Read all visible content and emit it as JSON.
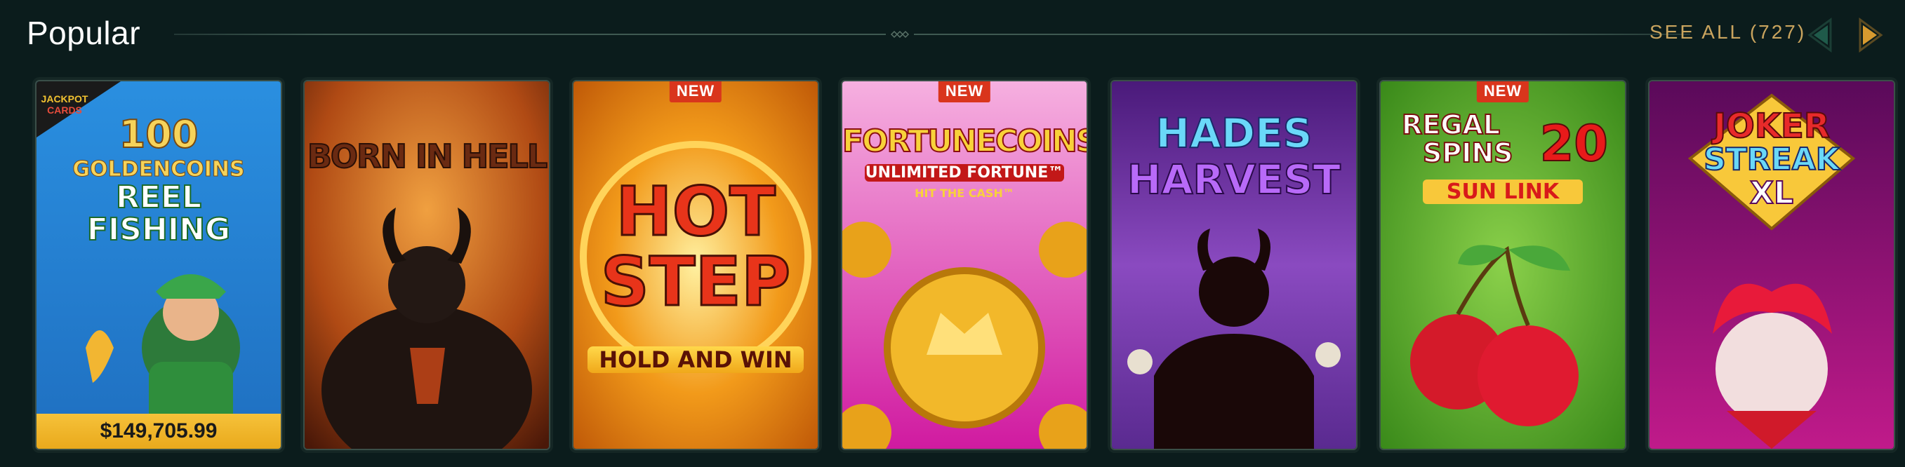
{
  "section": {
    "title": "Popular",
    "see_all_label": "SEE ALL (727)"
  },
  "nav": {
    "prev_icon": "chevron-left-icon",
    "next_icon": "chevron-right-icon",
    "prev_color": "#1f5a4a",
    "next_color": "#d79a2f"
  },
  "games": [
    {
      "title": "100 GOLDENCOINS REEL FISHING",
      "title_lines": [
        "100",
        "GOLDENCOINS",
        "REEL",
        "FISHING"
      ],
      "badge": "",
      "provider_tag": [
        "JACKPOT",
        "CARDS"
      ],
      "jackpot": "$149,705.99"
    },
    {
      "title": "BORN IN HELL",
      "title_lines": [
        "BORN IN HELL"
      ],
      "badge": ""
    },
    {
      "title": "HOT STEP HOLD AND WIN",
      "title_lines": [
        "HOT",
        "STEP",
        "HOLD AND WIN"
      ],
      "badge": "NEW"
    },
    {
      "title": "FORTUNE COINS UNLIMITED FORTUNE HIT THE CASH",
      "title_lines": [
        "FORTUNECOINS",
        "UNLIMITED FORTUNE™",
        "HIT THE CASH™"
      ],
      "badge": "NEW"
    },
    {
      "title": "HADES HARVEST",
      "title_lines": [
        "HADES",
        "HARVEST"
      ],
      "badge": ""
    },
    {
      "title": "REGAL SPINS 20 SUN LINK",
      "title_lines": [
        "REGAL",
        "SPINS",
        "20",
        "SUN LINK"
      ],
      "badge": "NEW"
    },
    {
      "title": "JOKER STREAK XL",
      "title_lines": [
        "JOKER",
        "STREAK",
        "XL"
      ],
      "badge": ""
    }
  ]
}
